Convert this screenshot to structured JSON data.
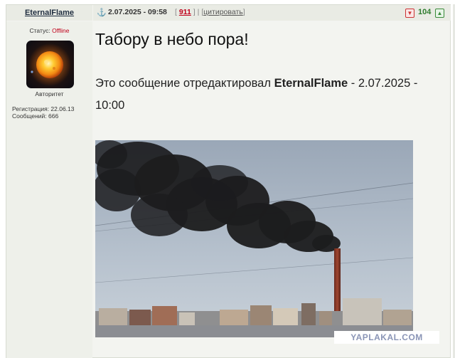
{
  "post": {
    "username": "EternalFlame",
    "date": "2.07.2025 - 09:58",
    "bracket_open": "[",
    "bracket_close": "]",
    "reply_count": "911",
    "separator": "|",
    "quote_label": "цитировать",
    "rating": "104",
    "title": "Табору в небо пора!",
    "edit_prefix": "Это сообщение отредактировал ",
    "edit_author": "EternalFlame",
    "edit_suffix": " - 2.07.2025 - 10:00"
  },
  "profile": {
    "status_label": "Статус: ",
    "status_value": "Offline",
    "rank": "Авторитет",
    "registration": "Регистрация: 22.06.13",
    "messages": "Сообщений: 666"
  },
  "watermark": "YAPLAKAL.COM",
  "colors": {
    "status_offline": "#c0001a",
    "rating": "#2f7d2f",
    "link": "#2a5aa8"
  },
  "icons": {
    "anchor": "anchor-icon",
    "vote_down": "thumbs-down-icon",
    "vote_up": "thumbs-up-icon"
  }
}
